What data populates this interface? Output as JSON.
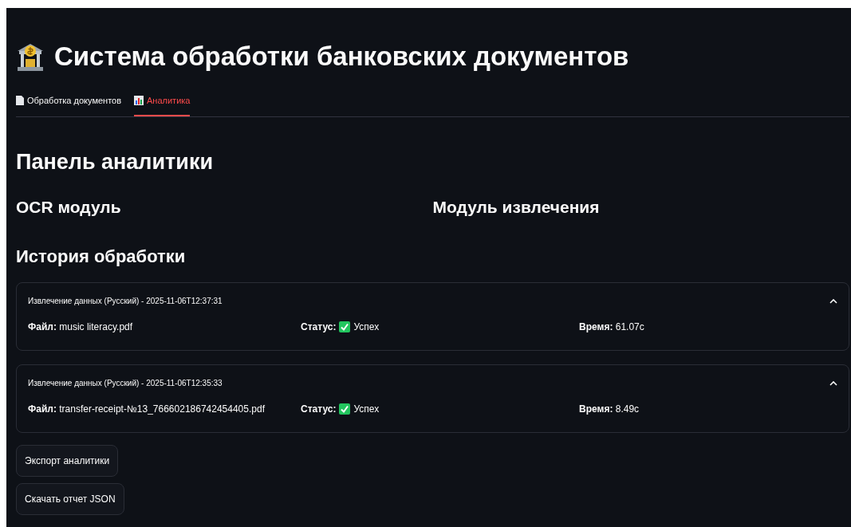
{
  "title": "Система обработки банковских документов",
  "tabs": [
    {
      "label": "Обработка документов",
      "kind": "page",
      "selected": false
    },
    {
      "label": "Аналитика",
      "kind": "chart",
      "selected": true
    }
  ],
  "heading": "Панель аналитики",
  "modules": [
    "OCR модуль",
    "Модуль извлечения"
  ],
  "history_heading": "История обработки",
  "history": [
    {
      "title": "Извлечение данных (Русский) - 2025-11-06T12:37:31",
      "expanded": true,
      "file": "**Файл:** music literacy.pdf",
      "status_label": "Статус:",
      "status_ok": true,
      "status_value": "Успех",
      "time": "**Время:** 61.07с"
    },
    {
      "title": "Извлечение данных (Русский) - 2025-11-06T12:35:33",
      "expanded": true,
      "file": "**Файл:** transfer-receipt-№13_766602186742454405.pdf",
      "status_label": "Статус:",
      "status_ok": true,
      "status_value": "Успех",
      "time": "**Время:** 8.49с"
    }
  ],
  "buttons": [
    "Экспорт аналитики",
    "Скачать отчет JSON"
  ]
}
